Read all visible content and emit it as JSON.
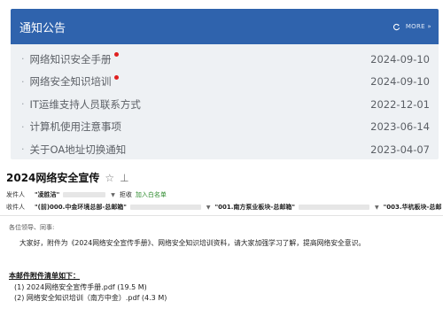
{
  "notice": {
    "title": "通知公告",
    "more_label": "MORE",
    "items": [
      {
        "text": "网络知识安全手册",
        "date": "2024-09-10",
        "is_new": true
      },
      {
        "text": "网络安全知识培训",
        "date": "2024-09-10",
        "is_new": true
      },
      {
        "text": "IT运维支持人员联系方式",
        "date": "2022-12-01",
        "is_new": false
      },
      {
        "text": "计算机使用注意事项",
        "date": "2023-06-14",
        "is_new": false
      },
      {
        "text": "关于OA地址切换通知",
        "date": "2023-04-07",
        "is_new": false
      }
    ]
  },
  "mail": {
    "subject": "2024网络安全宣传",
    "from_label": "发件人",
    "from_name": "\"凌胜洁\"",
    "reject_label": "拒收",
    "whitelist_label": "加入白名单",
    "to_label": "收件人",
    "to_1": "\"(前)000.中金环境总部-总邮箱\"",
    "to_2": "\"001.南方泵业板块-总邮箱\"",
    "to_3": "\"003.华杭板块-总邮",
    "greeting": "各位领导、同事:",
    "body": "大家好，附件为《2024网络安全宣传手册》、网络安全知识培训资料，请大家加强学习了解，提高网络安全意识。",
    "attachments_title": "本邮件附件清单如下：",
    "attachments": [
      "(1) 2024网络安全宣传手册.pdf (19.5 M)",
      "(2) 网络安全知识培训（南方中金）.pdf (4.3 M)"
    ]
  },
  "colors": {
    "header_blue": "#2f63ad",
    "panel_bg": "#eef1f4",
    "new_dot": "#e02020",
    "link_green": "#2e8b2e"
  }
}
